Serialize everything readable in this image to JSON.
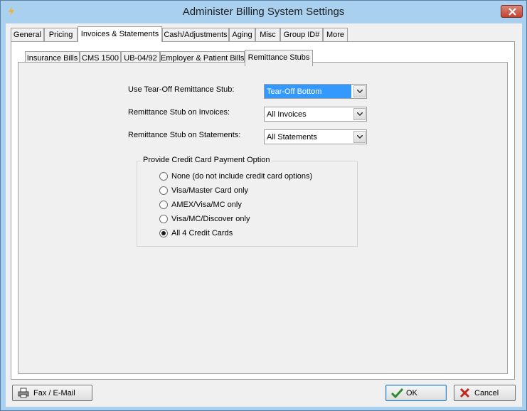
{
  "window": {
    "title": "Administer Billing System Settings"
  },
  "tabs": [
    {
      "label": "General"
    },
    {
      "label": "Pricing"
    },
    {
      "label": "Invoices & Statements"
    },
    {
      "label": "Cash/Adjustments"
    },
    {
      "label": "Aging"
    },
    {
      "label": "Misc"
    },
    {
      "label": "Group ID#"
    },
    {
      "label": "More"
    }
  ],
  "active_tab": "Invoices & Statements",
  "subtabs": [
    {
      "label": "Insurance Bills"
    },
    {
      "label": "CMS 1500"
    },
    {
      "label": "UB-04/92"
    },
    {
      "label": "Employer & Patient Bills"
    },
    {
      "label": "Remittance Stubs"
    }
  ],
  "active_subtab": "Remittance Stubs",
  "fields": {
    "tear_off": {
      "label": "Use Tear-Off Remittance Stub:",
      "value": "Tear-Off Bottom"
    },
    "invoices": {
      "label": "Remittance Stub on Invoices:",
      "value": "All Invoices"
    },
    "statements": {
      "label": "Remittance Stub on Statements:",
      "value": "All Statements"
    }
  },
  "credit_card_group": {
    "title": "Provide Credit Card Payment Option",
    "options": [
      {
        "label": "None (do not include credit card options)",
        "checked": false
      },
      {
        "label": "Visa/Master Card only",
        "checked": false
      },
      {
        "label": "AMEX/Visa/MC only",
        "checked": false
      },
      {
        "label": "Visa/MC/Discover only",
        "checked": false
      },
      {
        "label": "All 4 Credit Cards",
        "checked": true
      }
    ]
  },
  "buttons": {
    "fax": "Fax / E-Mail",
    "ok": "OK",
    "cancel": "Cancel"
  },
  "colors": {
    "selection": "#3399ff",
    "title_bar": "#a9d0ef"
  },
  "icons": {
    "app": "lightning-icon",
    "close": "close-icon",
    "fax": "printer-icon",
    "ok": "checkmark-icon",
    "cancel": "x-icon"
  }
}
